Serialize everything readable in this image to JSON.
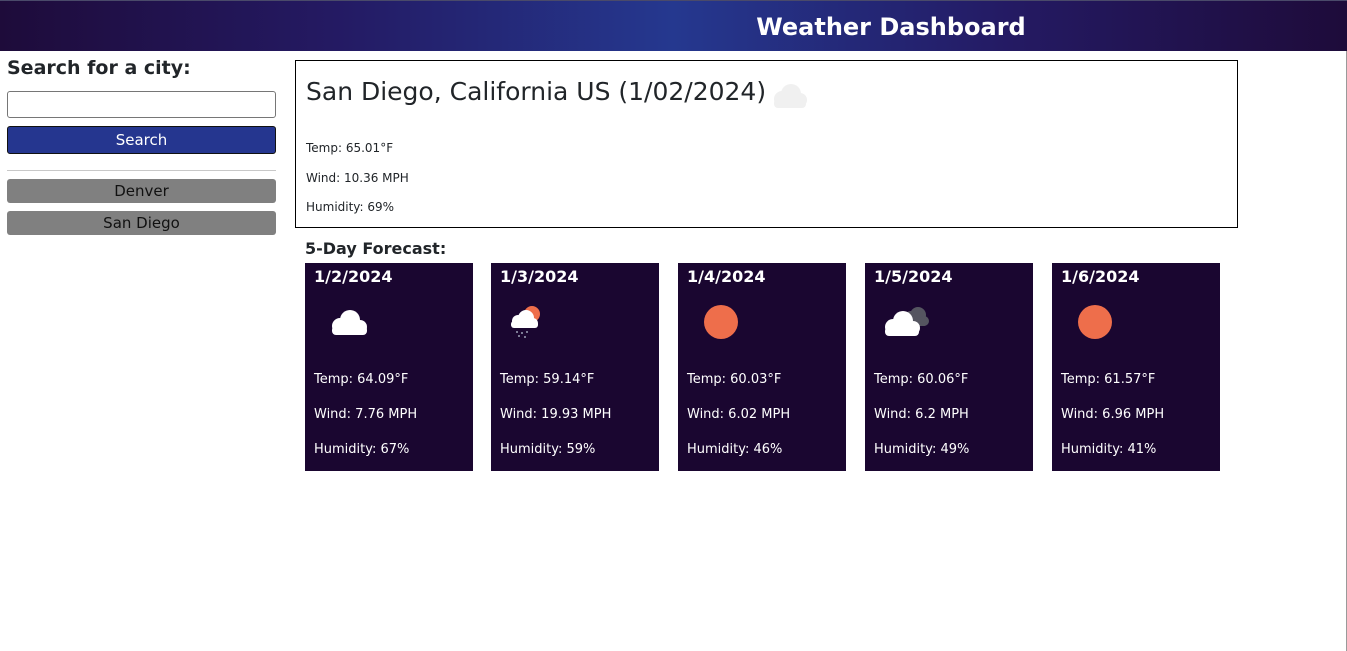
{
  "header": {
    "title": "Weather Dashboard"
  },
  "sidebar": {
    "heading": "Search for a city:",
    "search_value": "",
    "search_placeholder": "",
    "search_button": "Search",
    "history": [
      "Denver",
      "San Diego"
    ]
  },
  "current": {
    "title": "San Diego, California US (1/02/2024)",
    "icon": "cloud-icon",
    "temp": "Temp: 65.01°F",
    "wind": "Wind: 10.36 MPH",
    "humidity": "Humidity: 69%"
  },
  "forecast": {
    "title": "5-Day Forecast:",
    "days": [
      {
        "date": "1/2/2024",
        "icon": "cloud-icon",
        "temp": "Temp: 64.09°F",
        "wind": "Wind: 7.76 MPH",
        "humidity": "Humidity: 67%"
      },
      {
        "date": "1/3/2024",
        "icon": "sun-rain-cloud-icon",
        "temp": "Temp: 59.14°F",
        "wind": "Wind: 19.93 MPH",
        "humidity": "Humidity: 59%"
      },
      {
        "date": "1/4/2024",
        "icon": "sun-icon",
        "temp": "Temp: 60.03°F",
        "wind": "Wind: 6.02 MPH",
        "humidity": "Humidity: 46%"
      },
      {
        "date": "1/5/2024",
        "icon": "broken-clouds-icon",
        "temp": "Temp: 60.06°F",
        "wind": "Wind: 6.2 MPH",
        "humidity": "Humidity: 49%"
      },
      {
        "date": "1/6/2024",
        "icon": "sun-icon",
        "temp": "Temp: 61.57°F",
        "wind": "Wind: 6.96 MPH",
        "humidity": "Humidity: 41%"
      }
    ]
  },
  "colors": {
    "header_gradient_mid": "#25388f",
    "search_button": "#25368f",
    "history_button": "#808080",
    "card_bg": "#1a0630",
    "sun": "#ee6e4b"
  }
}
